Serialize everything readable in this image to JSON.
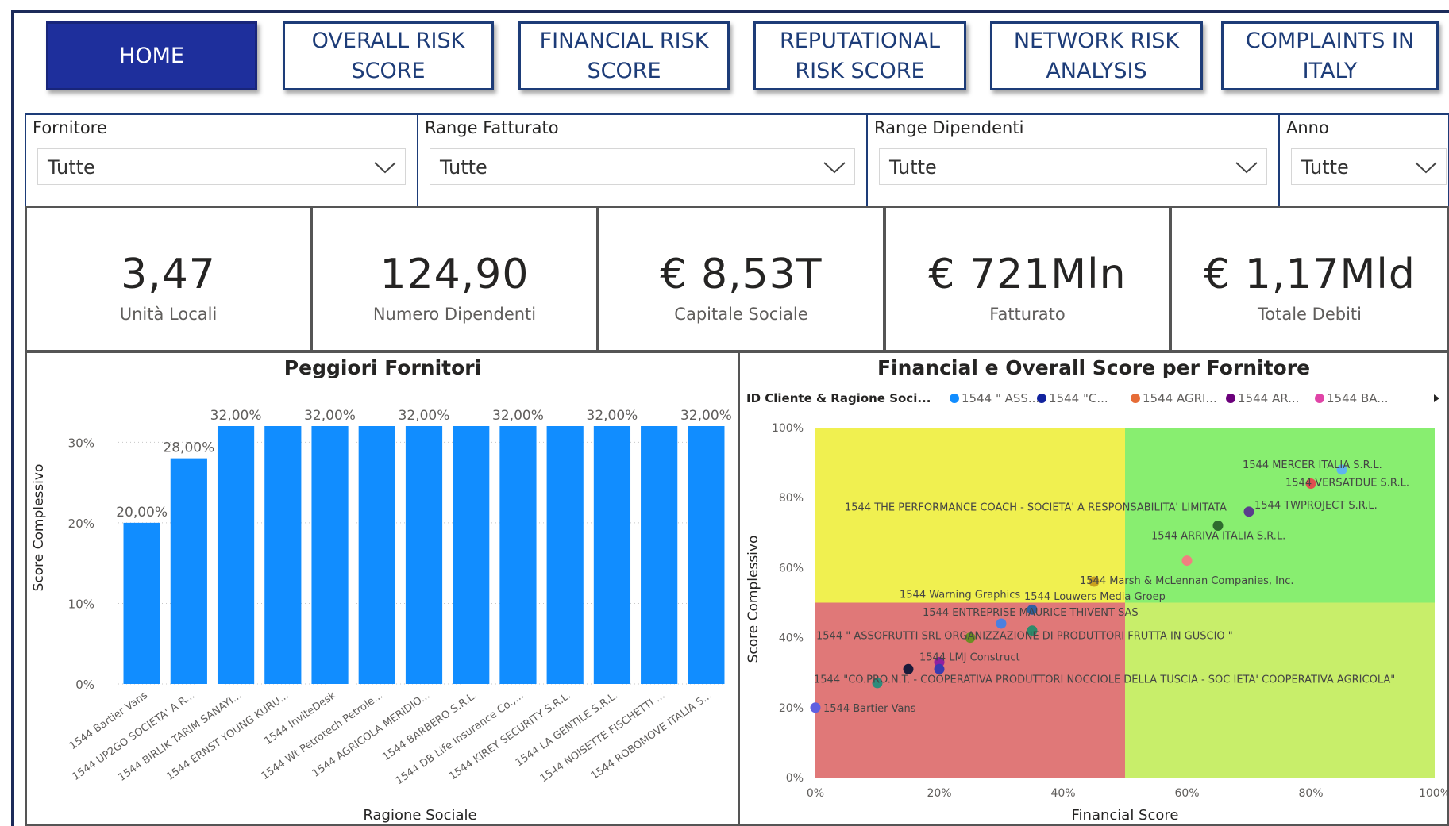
{
  "nav": [
    {
      "label": "HOME",
      "active": true
    },
    {
      "label": "OVERALL RISK SCORE",
      "active": false
    },
    {
      "label": "FINANCIAL RISK SCORE",
      "active": false
    },
    {
      "label": "REPUTATIONAL RISK SCORE",
      "active": false
    },
    {
      "label": "NETWORK RISK ANALYSIS",
      "active": false
    },
    {
      "label": "COMPLAINTS IN ITALY",
      "active": false
    }
  ],
  "filters": [
    {
      "label": "Fornitore",
      "value": "Tutte"
    },
    {
      "label": "Range Fatturato",
      "value": "Tutte"
    },
    {
      "label": "Range Dipendenti",
      "value": "Tutte"
    },
    {
      "label": "Anno",
      "value": "Tutte"
    }
  ],
  "kpis": [
    {
      "value": "3,47",
      "caption": "Unità Locali"
    },
    {
      "value": "124,90",
      "caption": "Numero Dipendenti"
    },
    {
      "value": "€ 8,53T",
      "caption": "Capitale Sociale"
    },
    {
      "value": "€ 721Mln",
      "caption": "Fatturato"
    },
    {
      "value": "€ 1,17Mld",
      "caption": "Totale Debiti"
    }
  ],
  "chart_data": [
    {
      "type": "bar",
      "title": "Peggiori Fornitori",
      "xlabel": "Ragione Sociale",
      "ylabel": "Score Complessivo",
      "ylim": [
        0,
        32
      ],
      "yticks": [
        "0%",
        "10%",
        "20%",
        "30%"
      ],
      "grid": true,
      "bar_color": "#118dff",
      "categories": [
        "1544 Bartier Vans",
        "1544 UP2GO SOCIETA' A R...",
        "1544 BIRLIK TARIM SANAYI...",
        "1544 ERNST YOUNG KURU...",
        "1544 InviteDesk",
        "1544 Wt Petrotech Petrole...",
        "1544 AGRICOLA MERIDIO...",
        "1544 BARBERO S.R.L.",
        "1544 DB Life Insurance Co.,...",
        "1544 KIREY SECURITY S.R.L.",
        "1544 LA GENTILE S.R.L.",
        "1544 NOISETTE FISCHETTI ...",
        "1544 ROBOMOVE ITALIA S..."
      ],
      "values": [
        20,
        28,
        32,
        32,
        32,
        32,
        32,
        32,
        32,
        32,
        32,
        32,
        32
      ],
      "data_labels": [
        "20,00%",
        "28,00%",
        "32,00%",
        "",
        "32,00%",
        "",
        "32,00%",
        "",
        "32,00%",
        "",
        "32,00%",
        "",
        "32,00%"
      ]
    },
    {
      "type": "scatter",
      "title": "Financial e Overall Score per Fornitore",
      "xlabel": "Financial Score",
      "ylabel": "Score Complessivo",
      "xlim": [
        0,
        100
      ],
      "ylim": [
        0,
        100
      ],
      "xticks": [
        "0%",
        "20%",
        "40%",
        "60%",
        "80%",
        "100%"
      ],
      "yticks": [
        "0%",
        "20%",
        "40%",
        "60%",
        "80%",
        "100%"
      ],
      "legend_title": "ID Cliente & Ragione Soci...",
      "legend": [
        {
          "name": "1544 \" ASS...",
          "color": "#118dff"
        },
        {
          "name": "1544 \"C...",
          "color": "#12239e"
        },
        {
          "name": "1544 AGRI...",
          "color": "#e66c37"
        },
        {
          "name": "1544 AR...",
          "color": "#6b007b"
        },
        {
          "name": "1544 BA...",
          "color": "#e044a7"
        }
      ],
      "quadrants": [
        {
          "x": [
            0,
            50
          ],
          "y": [
            50,
            100
          ],
          "color": "#f0f050"
        },
        {
          "x": [
            50,
            100
          ],
          "y": [
            50,
            100
          ],
          "color": "#88ee70"
        },
        {
          "x": [
            0,
            50
          ],
          "y": [
            0,
            50
          ],
          "color": "#e07878"
        },
        {
          "x": [
            50,
            100
          ],
          "y": [
            0,
            50
          ],
          "color": "#c8ee6a"
        }
      ],
      "points": [
        {
          "label": "1544 MERCER ITALIA S.R.L.",
          "x": 85,
          "y": 88,
          "color": "#5fb4f0"
        },
        {
          "label": "1544 VERSATDUE S.R.L.",
          "x": 80,
          "y": 84,
          "color": "#e05050"
        },
        {
          "label": "1544 TWPROJECT S.R.L.",
          "x": 70,
          "y": 76,
          "color": "#5a3d8c"
        },
        {
          "label": "1544 THE PERFORMANCE COACH - SOCIETA' A RESPONSABILITA' LIMITATA",
          "x": 65,
          "y": 72,
          "color": "#2e6b2e"
        },
        {
          "label": "1544 ARRIVA ITALIA S.R.L.",
          "x": 60,
          "y": 62,
          "color": "#f08080"
        },
        {
          "label": "1544 Marsh & McLennan Companies, Inc.",
          "x": 45,
          "y": 56,
          "color": "#c8a020"
        },
        {
          "label": "1544 Warning Graphics",
          "x": 35,
          "y": 48,
          "color": "#3060a0"
        },
        {
          "label": "1544 Louwers Media Groep",
          "x": 30,
          "y": 44,
          "color": "#4a80e0"
        },
        {
          "label": "1544 ENTREPRISE MAURICE THIVENT SAS",
          "x": 35,
          "y": 42,
          "color": "#2e8b6b"
        },
        {
          "label": "1544 \" ASSOFRUTTI SRL ORGANIZZAZIONE DI PRODUTTORI FRUTTA IN GUSCIO \"",
          "x": 25,
          "y": 40,
          "color": "#6b8e23"
        },
        {
          "label": "1544 LMJ Construct",
          "x": 20,
          "y": 33,
          "color": "#9020a0"
        },
        {
          "label": "1544 \"CO.PRO.N.T. - COOPERATIVA PRODUTTORI NOCCIOLE DELLA TUSCIA - SOC IETA' COOPERATIVA AGRICOLA\"",
          "x": 15,
          "y": 31,
          "color": "#1a1a3a"
        },
        {
          "label": "",
          "x": 20,
          "y": 31,
          "color": "#3a3ab0"
        },
        {
          "label": "",
          "x": 10,
          "y": 27,
          "color": "#2e8b7b"
        },
        {
          "label": "1544 Bartier Vans",
          "x": 0,
          "y": 20,
          "color": "#6060e0"
        }
      ]
    }
  ]
}
